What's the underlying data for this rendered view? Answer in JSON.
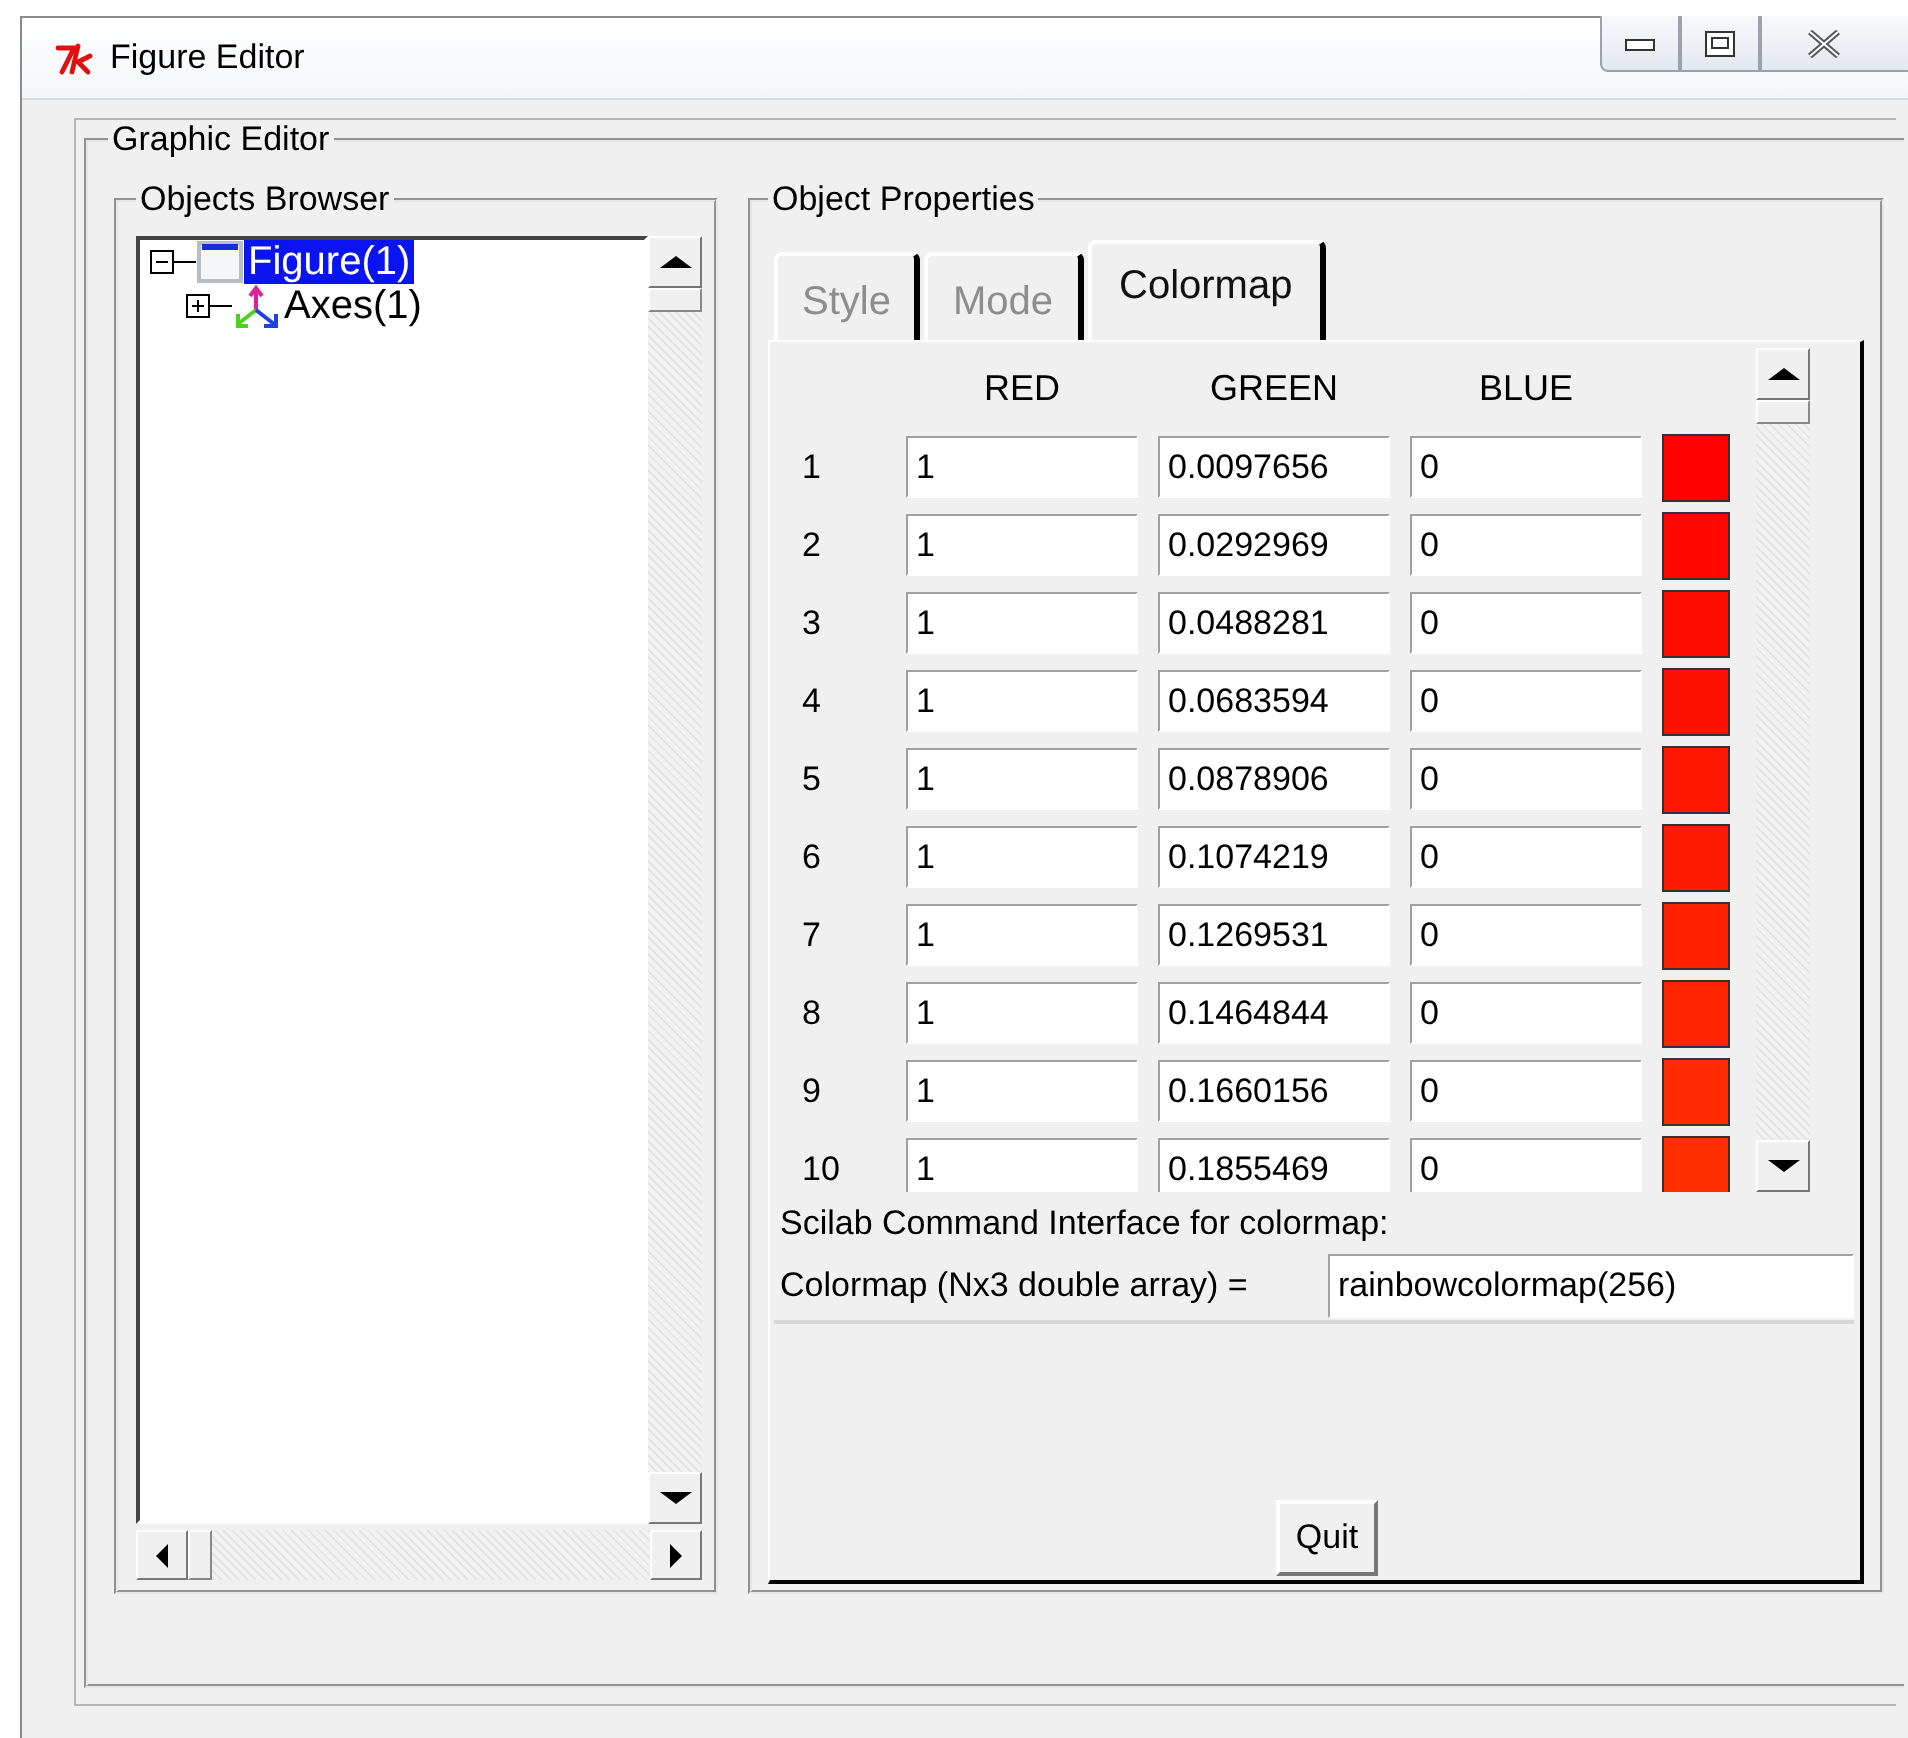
{
  "window": {
    "title": "Figure Editor"
  },
  "editor": {
    "title": "Graphic Editor"
  },
  "browser": {
    "title": "Objects Browser",
    "tree": [
      {
        "label": "Figure(1)",
        "kind": "figure",
        "expanded": true,
        "selected": true,
        "children": [
          {
            "label": "Axes(1)",
            "kind": "axes",
            "expanded": false,
            "selected": false
          }
        ]
      }
    ]
  },
  "properties": {
    "title": "Object Properties",
    "tabs": [
      {
        "label": "Style",
        "selected": false
      },
      {
        "label": "Mode",
        "selected": false
      },
      {
        "label": "Colormap",
        "selected": true
      }
    ],
    "colormap": {
      "columns": [
        "RED",
        "GREEN",
        "BLUE"
      ],
      "rows": [
        {
          "index": "1",
          "red": "1",
          "green": "0.0097656",
          "blue": "0",
          "color": "#ff0200"
        },
        {
          "index": "2",
          "red": "1",
          "green": "0.0292969",
          "blue": "0",
          "color": "#ff0700"
        },
        {
          "index": "3",
          "red": "1",
          "green": "0.0488281",
          "blue": "0",
          "color": "#ff0c00"
        },
        {
          "index": "4",
          "red": "1",
          "green": "0.0683594",
          "blue": "0",
          "color": "#ff1100"
        },
        {
          "index": "5",
          "red": "1",
          "green": "0.0878906",
          "blue": "0",
          "color": "#ff1600"
        },
        {
          "index": "6",
          "red": "1",
          "green": "0.1074219",
          "blue": "0",
          "color": "#ff1b00"
        },
        {
          "index": "7",
          "red": "1",
          "green": "0.1269531",
          "blue": "0",
          "color": "#ff2000"
        },
        {
          "index": "8",
          "red": "1",
          "green": "0.1464844",
          "blue": "0",
          "color": "#ff2500"
        },
        {
          "index": "9",
          "red": "1",
          "green": "0.1660156",
          "blue": "0",
          "color": "#ff2a00"
        },
        {
          "index": "10",
          "red": "1",
          "green": "0.1855469",
          "blue": "0",
          "color": "#ff2f00"
        }
      ]
    },
    "command": {
      "title": "Scilab Command Interface for colormap:",
      "label": "Colormap (Nx3 double array) =",
      "value": "rainbowcolormap(256)"
    }
  },
  "buttons": [
    {
      "label": "Quit"
    }
  ]
}
